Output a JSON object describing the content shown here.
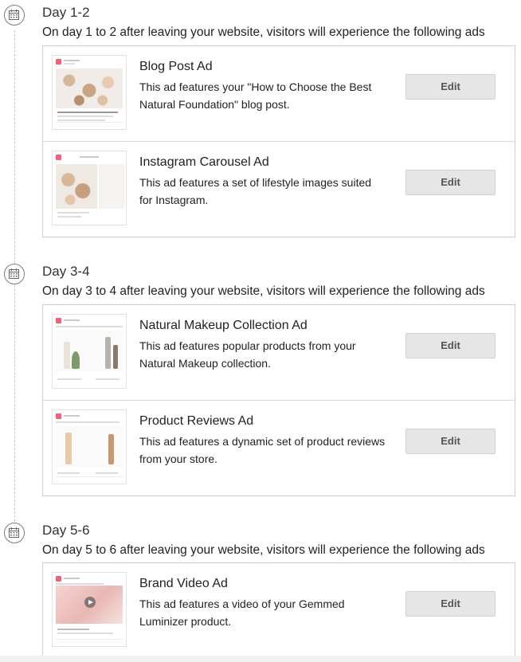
{
  "days": [
    {
      "title": "Day 1-2",
      "description": "On day 1 to 2 after leaving your website, visitors will experience the following ads",
      "ads": [
        {
          "title": "Blog Post Ad",
          "description": "This ad features your \"How to Choose the Best Natural Foundation\" blog post.",
          "edit_label": "Edit",
          "thumbnail": "blog-post-preview"
        },
        {
          "title": "Instagram Carousel Ad",
          "description": "This ad features a set of lifestyle images suited for Instagram.",
          "edit_label": "Edit",
          "thumbnail": "instagram-carousel-preview"
        }
      ]
    },
    {
      "title": "Day 3-4",
      "description": "On day 3 to 4 after leaving your website, visitors will experience the following ads",
      "ads": [
        {
          "title": "Natural Makeup Collection Ad",
          "description": "This ad features popular products from your Natural Makeup collection.",
          "edit_label": "Edit",
          "thumbnail": "collection-preview"
        },
        {
          "title": "Product Reviews Ad",
          "description": "This ad features a dynamic set of product reviews from your store.",
          "edit_label": "Edit",
          "thumbnail": "reviews-preview"
        }
      ]
    },
    {
      "title": "Day 5-6",
      "description": "On day 5 to 6 after leaving your website, visitors will experience the following ads",
      "ads": [
        {
          "title": "Brand Video Ad",
          "description": "This ad features a video of your Gemmed Luminizer product.",
          "edit_label": "Edit",
          "thumbnail": "video-preview"
        }
      ]
    }
  ],
  "icons": {
    "day_marker": "calendar-icon",
    "video": "play-icon"
  },
  "colors": {
    "brand_logo": "#f0627a",
    "edit_button_bg": "#e6e6e6",
    "border": "#cfcfcf"
  }
}
